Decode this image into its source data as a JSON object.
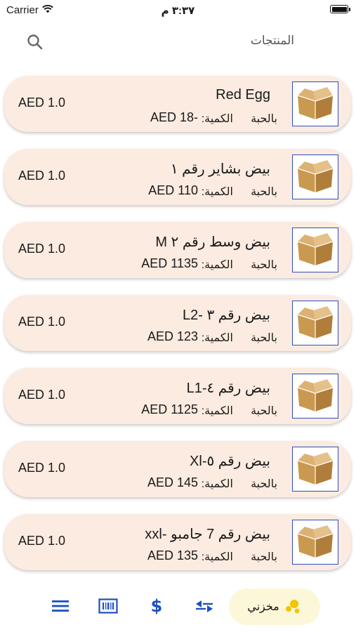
{
  "status_bar": {
    "carrier": "Carrier",
    "time": "٣:٣٧ م"
  },
  "header": {
    "title": "المنتجات"
  },
  "products": [
    {
      "name": "Red Egg",
      "unit": "بالحبة",
      "qty_label": "الكمية:",
      "qty_value": "AED 18-",
      "price": "AED 1.0"
    },
    {
      "name": "بيض بشاير رقم ١",
      "unit": "بالحبة",
      "qty_label": "الكمية:",
      "qty_value": "AED 110",
      "price": "AED 1.0"
    },
    {
      "name": "بيض وسط رقم ٢ M",
      "unit": "بالحبة",
      "qty_label": "الكمية:",
      "qty_value": "AED 1135",
      "price": "AED 1.0"
    },
    {
      "name": "بيض رقم ٣ -L2",
      "unit": "بالحبة",
      "qty_label": "الكمية:",
      "qty_value": "AED 123",
      "price": "AED 1.0"
    },
    {
      "name": "بيض رقم ٤-L1",
      "unit": "بالحبة",
      "qty_label": "الكمية:",
      "qty_value": "AED 1125",
      "price": "AED 1.0"
    },
    {
      "name": "بيض رقم ٥-Xl",
      "unit": "بالحبة",
      "qty_label": "الكمية:",
      "qty_value": "AED 145",
      "price": "AED 1.0"
    },
    {
      "name": "بيض رقم 7 جامبو -xxl",
      "unit": "بالحبة",
      "qty_label": "الكمية:",
      "qty_value": "AED 135",
      "price": "AED 1.0"
    }
  ],
  "bottom_nav": {
    "active_label": "مخزني",
    "icons": [
      "menu-icon",
      "barcode-icon",
      "dollar-icon",
      "swap-icon",
      "store-icon"
    ]
  },
  "colors": {
    "card_bg": "#fcebe0",
    "accent_blue": "#1e4fc0",
    "active_tab_bg": "#fdf7d9",
    "active_icon": "#f2c500"
  }
}
